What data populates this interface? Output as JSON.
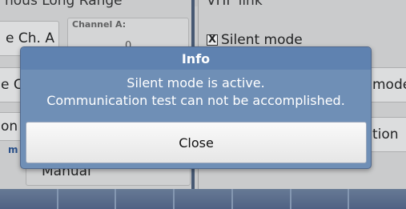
{
  "background": {
    "left_panel_title": "nous Long Range",
    "right_panel_title": "VHF link",
    "channel_a_button": "e Ch. A",
    "channel_a_label": "Channel A:",
    "channel_a_value": "0",
    "left_button_2": "e C",
    "left_button_3": "on",
    "mode_label": "m",
    "manual_value": "Manual",
    "silent_mode_label": "Silent mode",
    "silent_mode_checked": "X",
    "right_button_1": "mode",
    "right_button_2": "tion"
  },
  "dialog": {
    "title": "Info",
    "message_line1": "Silent mode is active.",
    "message_line2": "Communication test can not be accomplished.",
    "close_label": "Close"
  },
  "colors": {
    "dialog_bg": "#6f8fb6",
    "dialog_title_bg": "#5f82b0",
    "bottom_bar": "#5f7293"
  }
}
